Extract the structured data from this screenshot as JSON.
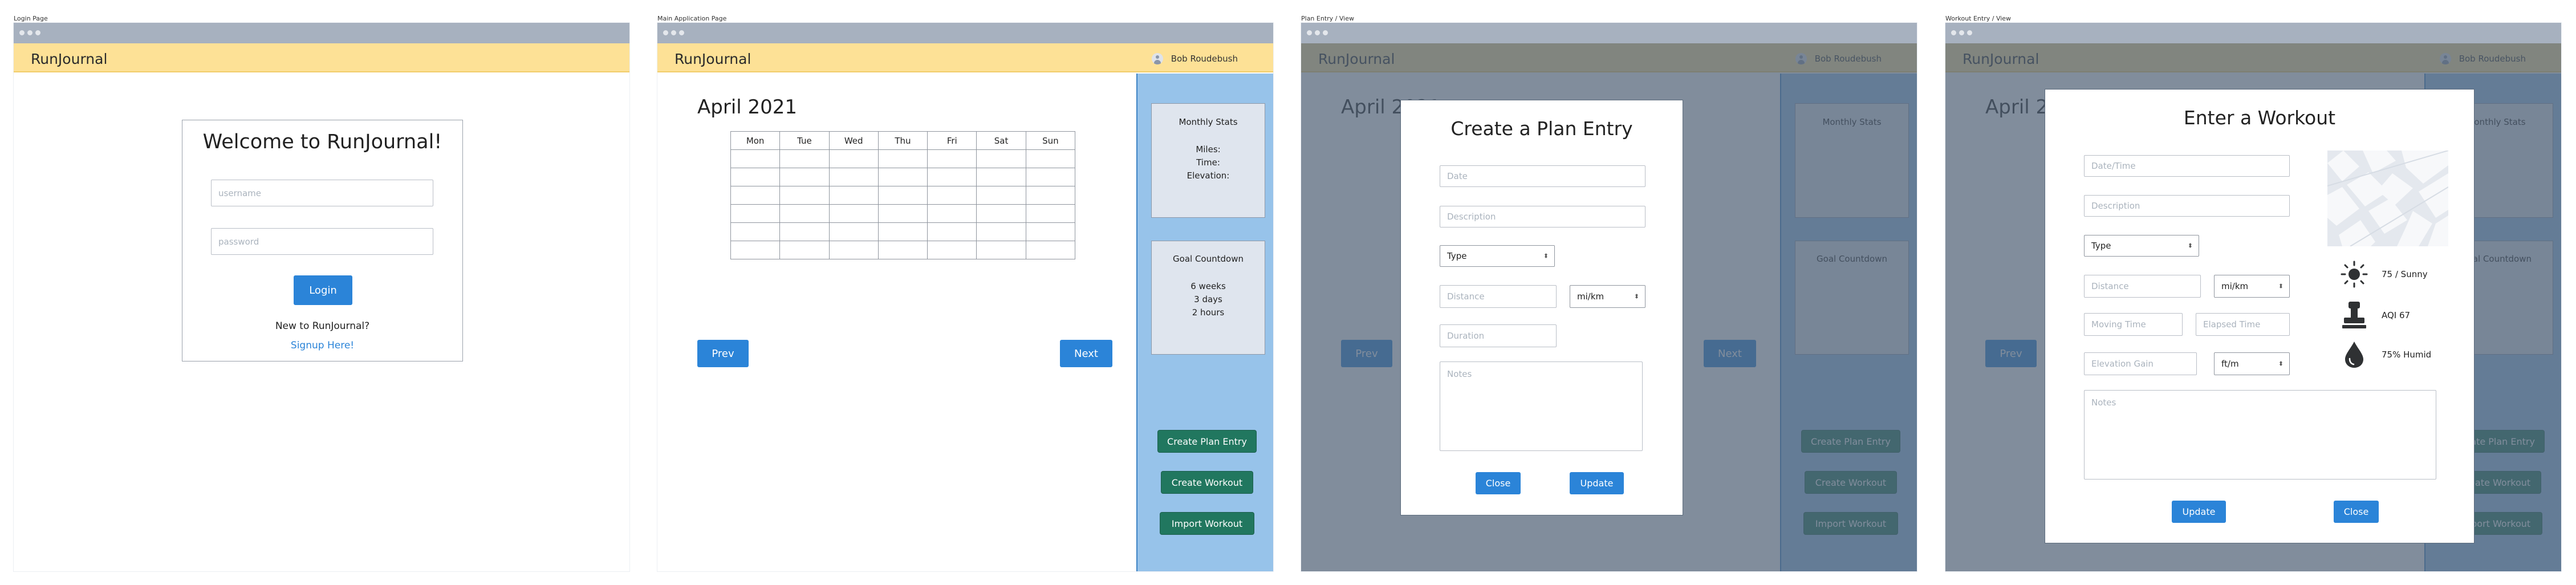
{
  "panels": {
    "login": "Login Page",
    "main": "Main Application Page",
    "plan": "Plan Entry / View",
    "workout": "Workout Entry / View"
  },
  "app": {
    "brand": "RunJournal",
    "user": "Bob Roudebush"
  },
  "login": {
    "title": "Welcome to RunJournal!",
    "username_placeholder": "username",
    "password_placeholder": "password",
    "login_label": "Login",
    "new_prompt": "New to RunJournal?",
    "signup_link": "Signup Here!"
  },
  "calendar": {
    "month": "April 2021",
    "days": [
      "Mon",
      "Tue",
      "Wed",
      "Thu",
      "Fri",
      "Sat",
      "Sun"
    ],
    "prev_label": "Prev",
    "next_label": "Next"
  },
  "sidebar": {
    "stats_title": "Monthly Stats",
    "stats_lines": [
      "Miles:",
      "Time:",
      "Elevation:"
    ],
    "goal_title": "Goal Countdown",
    "goal_lines": [
      "6 weeks",
      "3 days",
      "2 hours"
    ],
    "create_plan_label": "Create Plan Entry",
    "create_workout_label": "Create Workout",
    "import_workout_label": "Import Workout"
  },
  "plan_modal": {
    "title": "Create a Plan Entry",
    "date_placeholder": "Date",
    "description_placeholder": "Description",
    "type_value": "Type",
    "distance_placeholder": "Distance",
    "unit_value": "mi/km",
    "duration_placeholder": "Duration",
    "notes_placeholder": "Notes",
    "close_label": "Close",
    "update_label": "Update"
  },
  "workout_modal": {
    "title": "Enter a Workout",
    "datetime_placeholder": "Date/Time",
    "description_placeholder": "Description",
    "type_value": "Type",
    "distance_placeholder": "Distance",
    "distance_unit": "mi/km",
    "moving_time_placeholder": "Moving Time",
    "elapsed_time_placeholder": "Elapsed Time",
    "elevation_placeholder": "Elevation Gain",
    "elevation_unit": "ft/m",
    "notes_placeholder": "Notes",
    "weather": "75 / Sunny",
    "aqi": "AQI 67",
    "humidity": "75% Humid",
    "update_label": "Update",
    "close_label": "Close"
  },
  "icons": [
    "sun-icon",
    "stamp-icon",
    "droplet-icon",
    "avatar-icon",
    "map-thumbnail"
  ],
  "colors": {
    "appbar": "#fde196",
    "primary": "#2b84d8",
    "secondary": "#21775f",
    "sidebar": "#97c3ea"
  }
}
